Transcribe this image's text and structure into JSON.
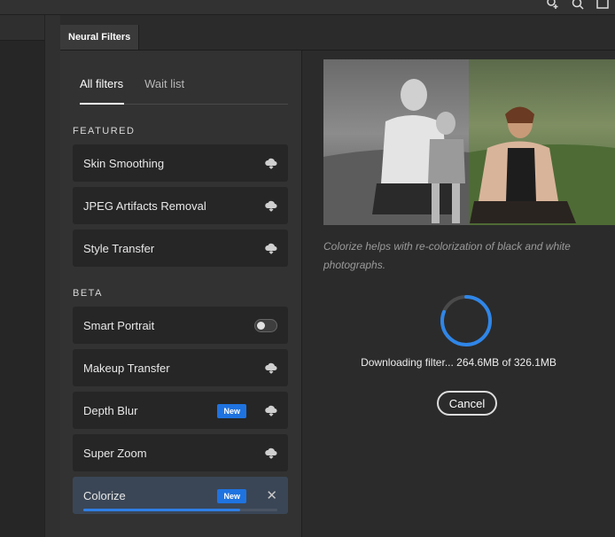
{
  "panel": {
    "tab_title": "Neural Filters"
  },
  "filter_tabs": [
    {
      "label": "All filters",
      "active": true
    },
    {
      "label": "Wait list",
      "active": false
    }
  ],
  "featured": {
    "heading": "FEATURED",
    "items": [
      {
        "label": "Skin Smoothing",
        "icon": "cloud-download-icon"
      },
      {
        "label": "JPEG Artifacts Removal",
        "icon": "cloud-download-icon"
      },
      {
        "label": "Style Transfer",
        "icon": "cloud-download-icon"
      }
    ]
  },
  "beta": {
    "heading": "BETA",
    "items": [
      {
        "label": "Smart Portrait",
        "control": "toggle",
        "toggle_on": false
      },
      {
        "label": "Makeup Transfer",
        "icon": "cloud-download-icon"
      },
      {
        "label": "Depth Blur",
        "badge": "New",
        "icon": "cloud-download-icon"
      },
      {
        "label": "Super Zoom",
        "icon": "cloud-download-icon"
      },
      {
        "label": "Colorize",
        "badge": "New",
        "icon": "close-icon",
        "selected": true,
        "download_progress": 0.81
      }
    ]
  },
  "preview": {
    "description": "Colorize helps with re-colorization of black and white photographs.",
    "status": "Downloading filter... 264.6MB of 326.1MB",
    "progress_fraction": 0.81,
    "cancel_label": "Cancel"
  },
  "colors": {
    "accent": "#1f73e0",
    "progress": "#2f7fe6",
    "selected_row": "#3a4656"
  }
}
